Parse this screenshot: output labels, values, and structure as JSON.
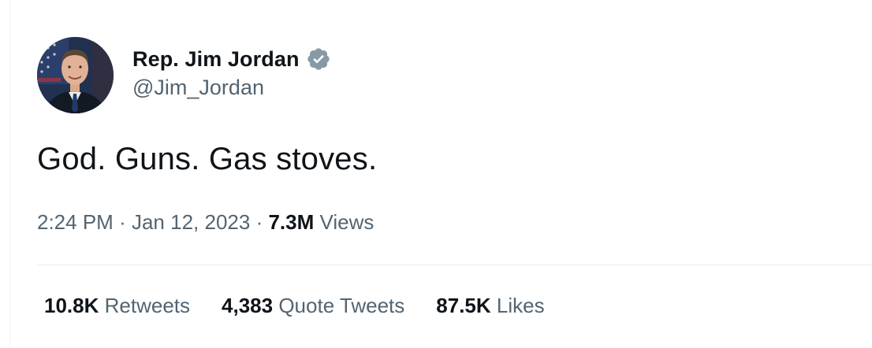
{
  "tweet": {
    "author": {
      "display_name": "Rep. Jim Jordan",
      "handle": "@Jim_Jordan",
      "verified": true,
      "verified_color": "#8899a6",
      "avatar": "profile-photo"
    },
    "text": "God. Guns. Gas stoves.",
    "time": "2:24 PM",
    "separator": "·",
    "date": "Jan 12, 2023",
    "views_count": "7.3M",
    "views_label": "Views",
    "stats": [
      {
        "count": "10.8K",
        "label": "Retweets"
      },
      {
        "count": "4,383",
        "label": "Quote Tweets"
      },
      {
        "count": "87.5K",
        "label": "Likes"
      }
    ]
  },
  "colors": {
    "primary_text": "#0f1419",
    "secondary_text": "#536471",
    "divider": "#e6ecf0"
  }
}
